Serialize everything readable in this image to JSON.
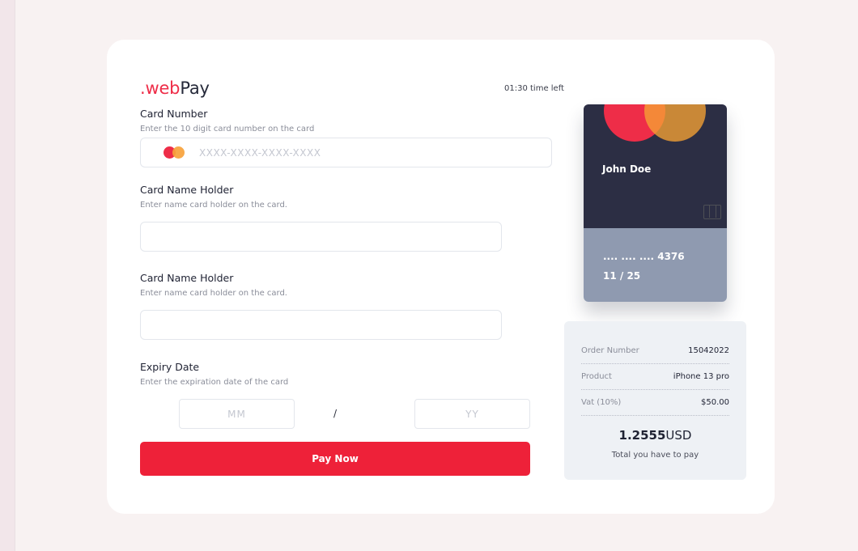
{
  "brand": {
    "accent": ".web",
    "rest": "Pay"
  },
  "timer": "01:30 time left",
  "card_number": {
    "label": "Card Number",
    "hint": "Enter the 10 digit card number on the card",
    "placeholder": "XXXX-XXXX-XXXX-XXXX",
    "value": ""
  },
  "holder_1": {
    "label": "Card Name Holder",
    "hint": "Enter name card holder on the card.",
    "value": ""
  },
  "holder_2": {
    "label": "Card Name Holder",
    "hint": "Enter name card holder on the card.",
    "value": ""
  },
  "expiry": {
    "label": "Expiry Date",
    "hint": "Enter the expiration date of the card",
    "month_placeholder": "MM",
    "year_placeholder": "YY",
    "separator": "/"
  },
  "pay_button": "Pay Now",
  "card_preview": {
    "holder": "John Doe",
    "digits": ".... .... .... 4376",
    "expiry": "11 / 25"
  },
  "summary": {
    "rows": [
      {
        "key": "Order Number",
        "value": "15042022"
      },
      {
        "key": "Product",
        "value": "iPhone 13 pro"
      },
      {
        "key": "Vat (10%)",
        "value": "$50.00"
      }
    ],
    "total_amount": "1.2555",
    "total_currency": "USD",
    "total_caption": "Total you have to pay"
  },
  "colors": {
    "accent": "#ee2139",
    "card_dark": "#2c2e44",
    "card_light": "#8f9ab0",
    "page_background": "#f8f2f2"
  }
}
